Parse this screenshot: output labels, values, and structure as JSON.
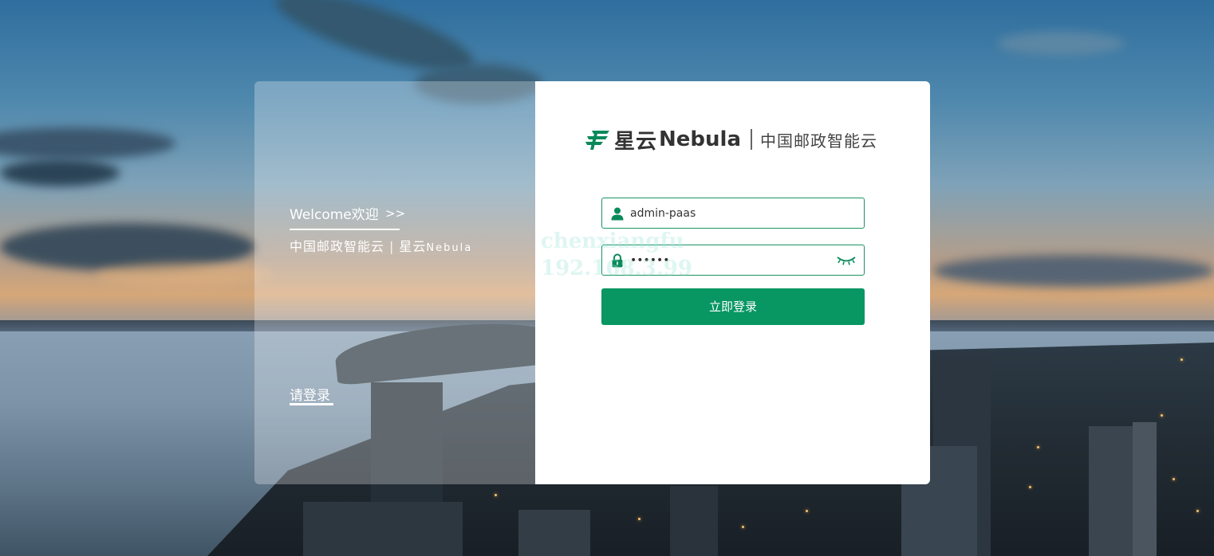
{
  "left_panel": {
    "welcome": "Welcome欢迎",
    "welcome_arrows": ">>",
    "subtitle_cn": "中国邮政智能云",
    "subtitle_sep": "|",
    "subtitle_star": "星云",
    "subtitle_en": "Nebula",
    "please_login": "请登录"
  },
  "logo": {
    "name_cn": "星云",
    "name_en": "Nebula",
    "tagline": "中国邮政智能云",
    "brand_color": "#0a8a5a"
  },
  "form": {
    "username_value": "admin-paas",
    "password_value": "••••••",
    "login_button": "立即登录",
    "accent_color": "#089663",
    "icons": {
      "username": "user-icon",
      "password": "lock-icon",
      "toggle": "eye-closed-icon"
    }
  },
  "watermark": {
    "line1": "chenxiangfu",
    "line2": "192.168.3.99"
  }
}
